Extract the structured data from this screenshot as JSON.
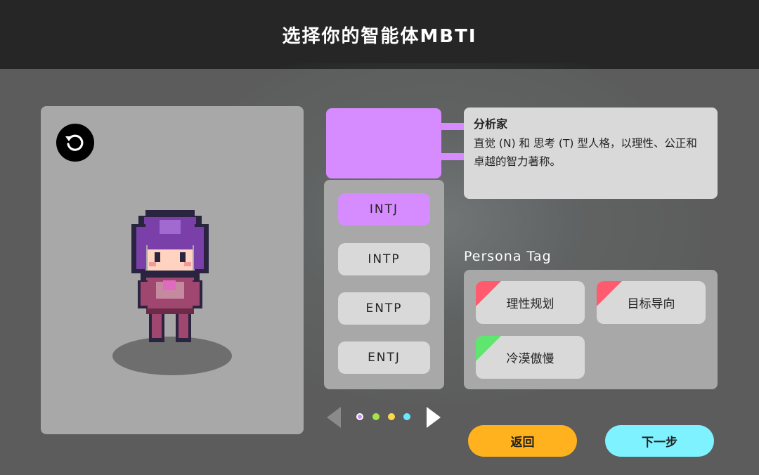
{
  "header": {
    "title": "选择你的智能体MBTI"
  },
  "preview": {
    "rotate_icon": "rotate-ccw-icon",
    "character": "pixel-character-purple-hair"
  },
  "mbti": {
    "accent_color": "#d68cff",
    "group_title": "分析家",
    "group_description": "直觉 (N) 和 思考 (T) 型人格，以理性、公正和卓越的智力著称。",
    "types": [
      {
        "label": "INTJ",
        "selected": true
      },
      {
        "label": "INTP",
        "selected": false
      },
      {
        "label": "ENTP",
        "selected": false
      },
      {
        "label": "ENTJ",
        "selected": false
      }
    ]
  },
  "pager": {
    "dots": [
      {
        "color": "#c98cff",
        "active": true
      },
      {
        "color": "#a6e34a",
        "active": false
      },
      {
        "color": "#ffd84a",
        "active": false
      },
      {
        "color": "#6fe6ff",
        "active": false
      }
    ]
  },
  "persona": {
    "label": "Persona Tag",
    "tags": [
      {
        "label": "理性规划",
        "corner_color": "#ff5a6e"
      },
      {
        "label": "目标导向",
        "corner_color": "#ff5a6e"
      },
      {
        "label": "冷漠傲慢",
        "corner_color": "#5ee66e"
      }
    ]
  },
  "actions": {
    "back_label": "返回",
    "next_label": "下一步"
  }
}
